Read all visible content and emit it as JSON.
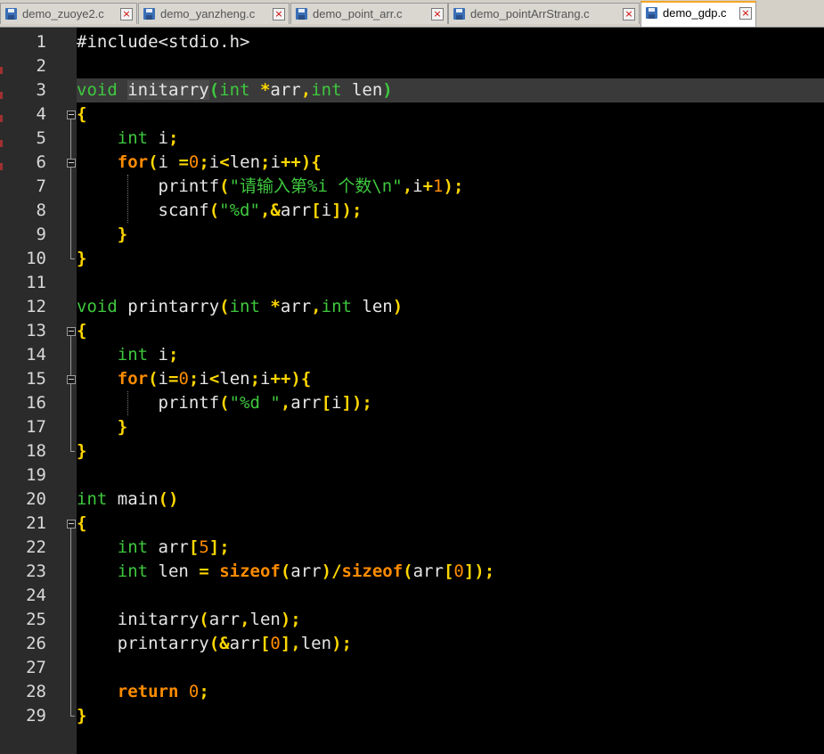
{
  "tabs": [
    {
      "label": "demo_zuoye2.c",
      "active": false
    },
    {
      "label": "demo_yanzheng.c",
      "active": false
    },
    {
      "label": "demo_point_arr.c",
      "active": false
    },
    {
      "label": "demo_pointArrStrang.c",
      "active": false
    },
    {
      "label": "demo_gdp.c",
      "active": true
    }
  ],
  "editor": {
    "highlighted_line": 3,
    "lines": [
      [
        [
          "pre",
          "#include<stdio.h>"
        ]
      ],
      [],
      [
        [
          "kw",
          "void"
        ],
        [
          "txt",
          " "
        ],
        [
          "idhl",
          "initarry"
        ],
        [
          "match",
          "("
        ],
        [
          "kw",
          "int"
        ],
        [
          "txt",
          " "
        ],
        [
          "op",
          "*"
        ],
        [
          "txt",
          "arr"
        ],
        [
          "op",
          ","
        ],
        [
          "kw",
          "int"
        ],
        [
          "txt",
          " len"
        ],
        [
          "match",
          ")"
        ]
      ],
      [
        [
          "brace",
          "{"
        ]
      ],
      [
        [
          "txt",
          "    "
        ],
        [
          "kw",
          "int"
        ],
        [
          "txt",
          " i"
        ],
        [
          "op",
          ";"
        ]
      ],
      [
        [
          "txt",
          "    "
        ],
        [
          "ctl",
          "for"
        ],
        [
          "op",
          "("
        ],
        [
          "txt",
          "i "
        ],
        [
          "op",
          "="
        ],
        [
          "num",
          "0"
        ],
        [
          "op",
          ";"
        ],
        [
          "txt",
          "i"
        ],
        [
          "op",
          "<"
        ],
        [
          "txt",
          "len"
        ],
        [
          "op",
          ";"
        ],
        [
          "txt",
          "i"
        ],
        [
          "op",
          "++"
        ],
        [
          "op",
          "){"
        ]
      ],
      [
        [
          "txt",
          "        printf"
        ],
        [
          "op",
          "("
        ],
        [
          "str",
          "\"请输入第%i 个数\\n\""
        ],
        [
          "op",
          ","
        ],
        [
          "txt",
          "i"
        ],
        [
          "op",
          "+"
        ],
        [
          "num",
          "1"
        ],
        [
          "op",
          ");"
        ]
      ],
      [
        [
          "txt",
          "        scanf"
        ],
        [
          "op",
          "("
        ],
        [
          "str",
          "\"%d\""
        ],
        [
          "op",
          ","
        ],
        [
          "op",
          "&"
        ],
        [
          "txt",
          "arr"
        ],
        [
          "op",
          "["
        ],
        [
          "txt",
          "i"
        ],
        [
          "op",
          "]);"
        ]
      ],
      [
        [
          "txt",
          "    "
        ],
        [
          "brace",
          "}"
        ]
      ],
      [
        [
          "brace",
          "}"
        ]
      ],
      [],
      [
        [
          "kw",
          "void"
        ],
        [
          "txt",
          " printarry"
        ],
        [
          "op",
          "("
        ],
        [
          "kw",
          "int"
        ],
        [
          "txt",
          " "
        ],
        [
          "op",
          "*"
        ],
        [
          "txt",
          "arr"
        ],
        [
          "op",
          ","
        ],
        [
          "kw",
          "int"
        ],
        [
          "txt",
          " len"
        ],
        [
          "op",
          ")"
        ]
      ],
      [
        [
          "brace",
          "{"
        ]
      ],
      [
        [
          "txt",
          "    "
        ],
        [
          "kw",
          "int"
        ],
        [
          "txt",
          " i"
        ],
        [
          "op",
          ";"
        ]
      ],
      [
        [
          "txt",
          "    "
        ],
        [
          "ctl",
          "for"
        ],
        [
          "op",
          "("
        ],
        [
          "txt",
          "i"
        ],
        [
          "op",
          "="
        ],
        [
          "num",
          "0"
        ],
        [
          "op",
          ";"
        ],
        [
          "txt",
          "i"
        ],
        [
          "op",
          "<"
        ],
        [
          "txt",
          "len"
        ],
        [
          "op",
          ";"
        ],
        [
          "txt",
          "i"
        ],
        [
          "op",
          "++"
        ],
        [
          "op",
          "){"
        ]
      ],
      [
        [
          "txt",
          "        printf"
        ],
        [
          "op",
          "("
        ],
        [
          "str",
          "\"%d \""
        ],
        [
          "op",
          ","
        ],
        [
          "txt",
          "arr"
        ],
        [
          "op",
          "["
        ],
        [
          "txt",
          "i"
        ],
        [
          "op",
          "]);"
        ]
      ],
      [
        [
          "txt",
          "    "
        ],
        [
          "brace",
          "}"
        ]
      ],
      [
        [
          "brace",
          "}"
        ]
      ],
      [],
      [
        [
          "kw",
          "int"
        ],
        [
          "txt",
          " main"
        ],
        [
          "op",
          "()"
        ]
      ],
      [
        [
          "brace",
          "{"
        ]
      ],
      [
        [
          "txt",
          "    "
        ],
        [
          "kw",
          "int"
        ],
        [
          "txt",
          " arr"
        ],
        [
          "op",
          "["
        ],
        [
          "num",
          "5"
        ],
        [
          "op",
          "];"
        ]
      ],
      [
        [
          "txt",
          "    "
        ],
        [
          "kw",
          "int"
        ],
        [
          "txt",
          " len "
        ],
        [
          "op",
          "="
        ],
        [
          "txt",
          " "
        ],
        [
          "ctl",
          "sizeof"
        ],
        [
          "op",
          "("
        ],
        [
          "txt",
          "arr"
        ],
        [
          "op",
          ")/"
        ],
        [
          "ctl",
          "sizeof"
        ],
        [
          "op",
          "("
        ],
        [
          "txt",
          "arr"
        ],
        [
          "op",
          "["
        ],
        [
          "num",
          "0"
        ],
        [
          "op",
          "]);"
        ]
      ],
      [],
      [
        [
          "txt",
          "    initarry"
        ],
        [
          "op",
          "("
        ],
        [
          "txt",
          "arr"
        ],
        [
          "op",
          ","
        ],
        [
          "txt",
          "len"
        ],
        [
          "op",
          ");"
        ]
      ],
      [
        [
          "txt",
          "    printarry"
        ],
        [
          "op",
          "(&"
        ],
        [
          "txt",
          "arr"
        ],
        [
          "op",
          "["
        ],
        [
          "num",
          "0"
        ],
        [
          "op",
          "],"
        ],
        [
          "txt",
          "len"
        ],
        [
          "op",
          ");"
        ]
      ],
      [],
      [
        [
          "txt",
          "    "
        ],
        [
          "ctl",
          "return"
        ],
        [
          "txt",
          " "
        ],
        [
          "num",
          "0"
        ],
        [
          "op",
          ";"
        ]
      ],
      [
        [
          "brace",
          "}"
        ]
      ]
    ]
  }
}
